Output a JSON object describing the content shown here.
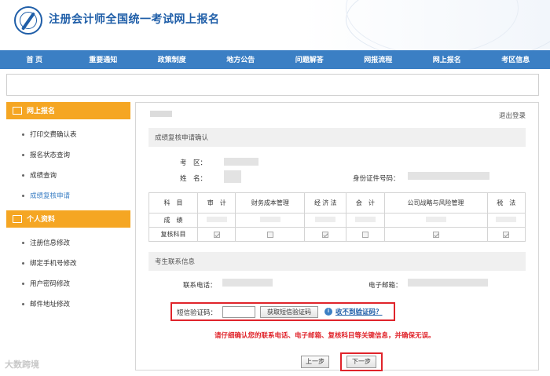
{
  "header": {
    "title": "注册会计师全国统一考试网上报名"
  },
  "nav": [
    "首 页",
    "重要通知",
    "政策制度",
    "地方公告",
    "问题解答",
    "网报流程",
    "网上报名",
    "考区信息"
  ],
  "sidebar": {
    "section1": "网上报名",
    "items1": [
      "打印交费确认表",
      "报名状态查询",
      "成绩查询",
      "成绩复核申请"
    ],
    "section2": "个人资料",
    "items2": [
      "注册信息修改",
      "绑定手机号修改",
      "用户密码修改",
      "邮件地址修改"
    ]
  },
  "main": {
    "logout": "退出登录",
    "section_review": "成绩复核申请确认",
    "exam_area_label": "考　区：",
    "name_label": "姓　名：",
    "id_label": "身份证件号码：",
    "table": {
      "header": [
        "科　目",
        "审　计",
        "财务成本管理",
        "经 济 法",
        "会　计",
        "公司战略与风险管理",
        "税　法"
      ],
      "row_score_label": "成　绩",
      "row_review_label": "复核科目",
      "review_checked": [
        true,
        false,
        true,
        false,
        true,
        true
      ]
    },
    "section_contact": "考生联系信息",
    "phone_label": "联系电话：",
    "email_label": "电子邮箱：",
    "sms_label": "短信验证码：",
    "sms_input_placeholder": "",
    "sms_button": "获取短信验证码",
    "no_code_link": "收不到验证码？",
    "warning": "请仔细确认您的联系电话、电子邮箱、复核科目等关键信息，并确保无误。",
    "prev": "上一步",
    "next": "下一步"
  },
  "watermark": "大数跨境"
}
